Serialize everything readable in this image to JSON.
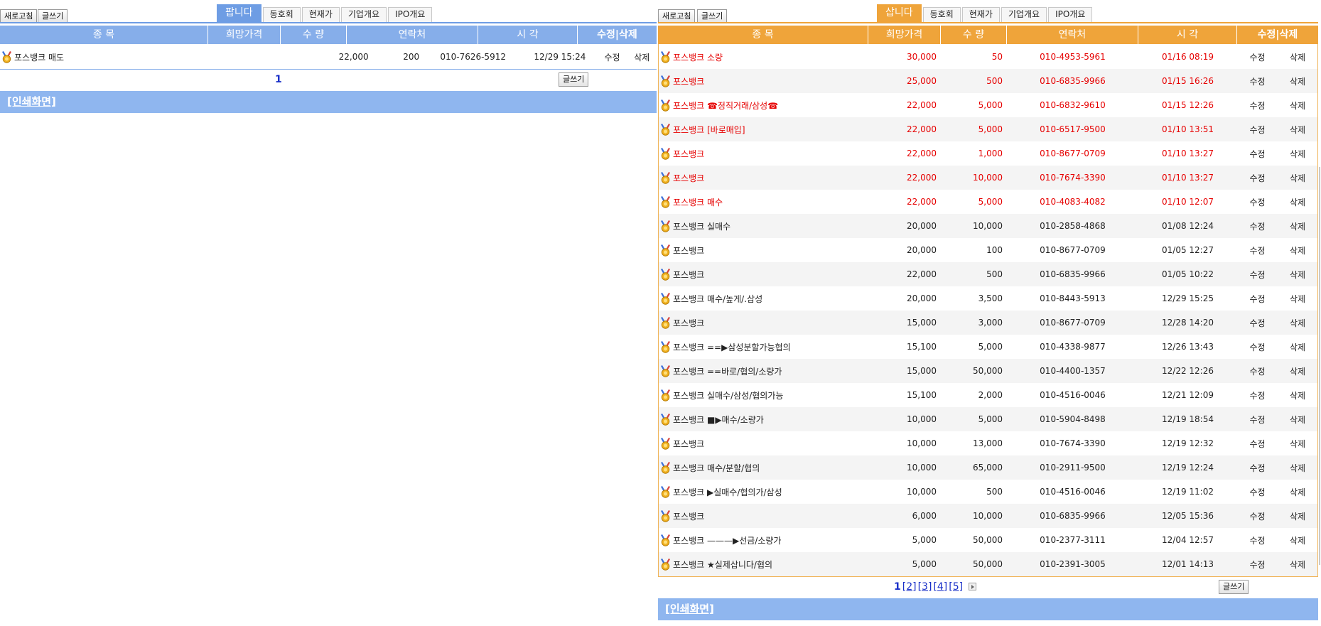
{
  "sell": {
    "toolbar": {
      "refresh": "새로고침",
      "write": "글쓰기"
    },
    "tabs": [
      {
        "label": "팝니다",
        "active": true
      },
      {
        "label": "동호회"
      },
      {
        "label": "현재가"
      },
      {
        "label": "기업개요"
      },
      {
        "label": "IPO개요"
      }
    ],
    "headers": {
      "name": "종       목",
      "price": "희망가격",
      "qty": "수 량",
      "contact": "연락처",
      "time": "시 각",
      "actions": "수정|삭제"
    },
    "rows": [
      {
        "name": "포스뱅크 매도",
        "price": "22,000",
        "qty": "200",
        "contact": "010-7626-5912",
        "time": "12/29 15:24",
        "edit": "수정",
        "delete": "삭제"
      }
    ],
    "pager": {
      "current": "1"
    },
    "write_bottom": "글쓰기",
    "print_link": "[인쇄화면]"
  },
  "buy": {
    "toolbar": {
      "refresh": "새로고침",
      "write": "글쓰기"
    },
    "tabs": [
      {
        "label": "삽니다",
        "active": true
      },
      {
        "label": "동호회"
      },
      {
        "label": "현재가"
      },
      {
        "label": "기업개요"
      },
      {
        "label": "IPO개요"
      }
    ],
    "headers": {
      "name": "종       목",
      "price": "희망가격",
      "qty": "수 량",
      "contact": "연락처",
      "time": "시 각",
      "actions": "수정|삭제"
    },
    "rows": [
      {
        "name": "포스뱅크 소량",
        "price": "30,000",
        "qty": "50",
        "contact": "010-4953-5961",
        "time": "01/16 08:19",
        "highlight": true
      },
      {
        "name": "포스뱅크",
        "price": "25,000",
        "qty": "500",
        "contact": "010-6835-9966",
        "time": "01/15 16:26",
        "highlight": true
      },
      {
        "name": "포스뱅크 ☎정직거래/삼성☎",
        "price": "22,000",
        "qty": "5,000",
        "contact": "010-6832-9610",
        "time": "01/15 12:26",
        "highlight": true
      },
      {
        "name": "포스뱅크 [바로매입]",
        "price": "22,000",
        "qty": "5,000",
        "contact": "010-6517-9500",
        "time": "01/10 13:51",
        "highlight": true
      },
      {
        "name": "포스뱅크",
        "price": "22,000",
        "qty": "1,000",
        "contact": "010-8677-0709",
        "time": "01/10 13:27",
        "highlight": true
      },
      {
        "name": "포스뱅크",
        "price": "22,000",
        "qty": "10,000",
        "contact": "010-7674-3390",
        "time": "01/10 13:27",
        "highlight": true
      },
      {
        "name": "포스뱅크 매수",
        "price": "22,000",
        "qty": "5,000",
        "contact": "010-4083-4082",
        "time": "01/10 12:07",
        "highlight": true
      },
      {
        "name": "포스뱅크 실매수",
        "price": "20,000",
        "qty": "10,000",
        "contact": "010-2858-4868",
        "time": "01/08 12:24"
      },
      {
        "name": "포스뱅크",
        "price": "20,000",
        "qty": "100",
        "contact": "010-8677-0709",
        "time": "01/05 12:27"
      },
      {
        "name": "포스뱅크",
        "price": "22,000",
        "qty": "500",
        "contact": "010-6835-9966",
        "time": "01/05 10:22"
      },
      {
        "name": "포스뱅크 매수/높게/.삼성",
        "price": "20,000",
        "qty": "3,500",
        "contact": "010-8443-5913",
        "time": "12/29 15:25"
      },
      {
        "name": "포스뱅크",
        "price": "15,000",
        "qty": "3,000",
        "contact": "010-8677-0709",
        "time": "12/28 14:20"
      },
      {
        "name": "포스뱅크 ==▶삼성분할가능협의",
        "price": "15,100",
        "qty": "5,000",
        "contact": "010-4338-9877",
        "time": "12/26 13:43"
      },
      {
        "name": "포스뱅크 ==바로/협의/소량가",
        "price": "15,000",
        "qty": "50,000",
        "contact": "010-4400-1357",
        "time": "12/22 12:26"
      },
      {
        "name": "포스뱅크 실매수/삼성/협의가능",
        "price": "15,100",
        "qty": "2,000",
        "contact": "010-4516-0046",
        "time": "12/21 12:09"
      },
      {
        "name": "포스뱅크 ■▶매수/소량가",
        "price": "10,000",
        "qty": "5,000",
        "contact": "010-5904-8498",
        "time": "12/19 18:54"
      },
      {
        "name": "포스뱅크",
        "price": "10,000",
        "qty": "13,000",
        "contact": "010-7674-3390",
        "time": "12/19 12:32"
      },
      {
        "name": "포스뱅크 매수/분할/협의",
        "price": "10,000",
        "qty": "65,000",
        "contact": "010-2911-9500",
        "time": "12/19 12:24"
      },
      {
        "name": "포스뱅크 ▶실매수/협의가/삼성",
        "price": "10,000",
        "qty": "500",
        "contact": "010-4516-0046",
        "time": "12/19 11:02"
      },
      {
        "name": "포스뱅크",
        "price": "6,000",
        "qty": "10,000",
        "contact": "010-6835-9966",
        "time": "12/05 15:36"
      },
      {
        "name": "포스뱅크 ———▶선금/소량가",
        "price": "5,000",
        "qty": "50,000",
        "contact": "010-2377-3111",
        "time": "12/04 12:57"
      },
      {
        "name": "포스뱅크 ★실제삽니다/협의",
        "price": "5,000",
        "qty": "50,000",
        "contact": "010-2391-3005",
        "time": "12/01 14:13"
      }
    ],
    "row_actions": {
      "edit": "수정",
      "delete": "삭제"
    },
    "pager": {
      "current": "1",
      "pages": [
        "[2]",
        "[3]",
        "[4]",
        "[5]"
      ]
    },
    "write_bottom": "글쓰기",
    "print_link": "[인쇄화면]"
  },
  "colors": {
    "sell_accent": "#6e9de4",
    "buy_accent": "#efa43a",
    "highlight_text": "#e60000",
    "pager_link": "#1a30c8"
  },
  "icons": {
    "row_icon": "medal-icon",
    "pager_next": "next-page-icon"
  }
}
